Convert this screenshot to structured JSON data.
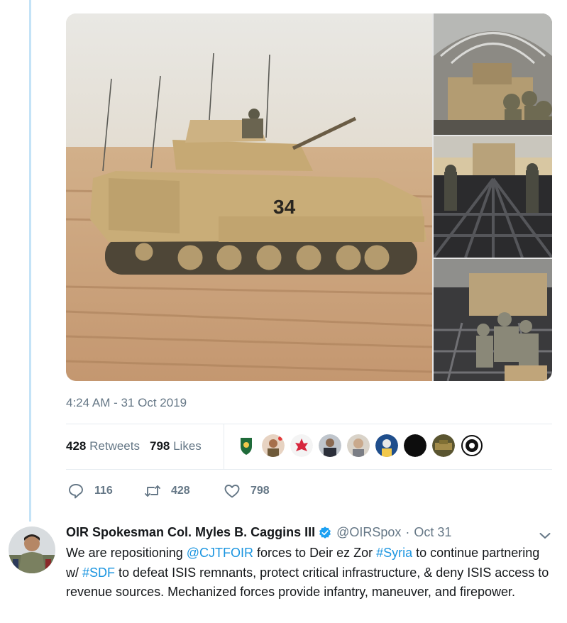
{
  "tweet": {
    "timestamp": "4:24 AM - 31 Oct 2019",
    "retweets_count": "428",
    "retweets_label": "Retweets",
    "likes_count": "798",
    "likes_label": "Likes",
    "actions": {
      "reply_count": "116",
      "retweet_count": "428",
      "like_count": "798"
    },
    "media": {
      "main_text": "34"
    },
    "liker_count": 9
  },
  "next_tweet": {
    "author_name": "OIR Spokesman Col. Myles B. Caggins III",
    "handle": "@OIRSpox",
    "separator": "·",
    "date": "Oct 31",
    "text_parts": [
      "We are repositioning ",
      "@CJTFOIR",
      " forces to Deir ez Zor ",
      "#Syria",
      " to continue partnering w/ ",
      "#SDF",
      " to defeat ISIS remnants, protect critical infrastructure, & deny ISIS access to revenue sources. Mechanized forces provide infantry, maneuver, and firepower."
    ]
  },
  "colors": {
    "link": "#1b95e0",
    "muted": "#657786",
    "thread_line": "#c4e3f7",
    "verified": "#1da1f2"
  },
  "icons": [
    "reply-icon",
    "retweet-icon",
    "like-icon",
    "verified-icon",
    "chevron-down-icon"
  ]
}
